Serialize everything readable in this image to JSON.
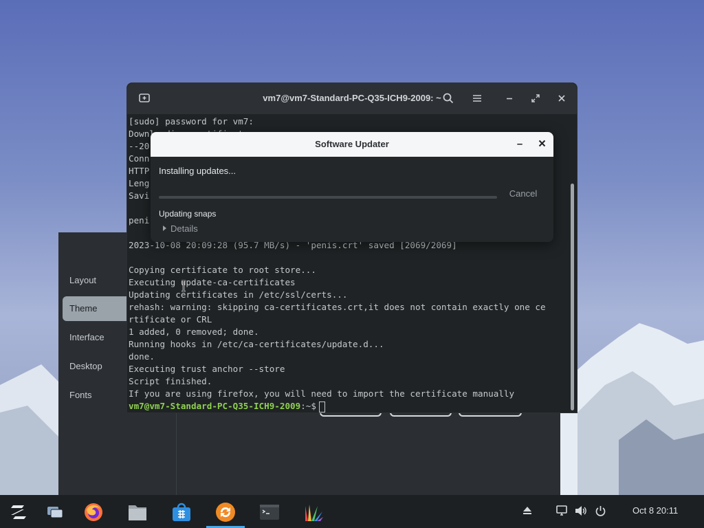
{
  "terminal": {
    "title": "vm7@vm7-Standard-PC-Q35-ICH9-2009: ~",
    "lines": [
      "[sudo] password for vm7:",
      "Downloading certificate",
      "--20",
      "Conn",
      "HTTP",
      "Leng",
      "Savi",
      "",
      "peni",
      "",
      "2023-10-08 20:09:28 (95.7 MB/s) - 'penis.crt' saved [2069/2069]",
      "",
      "Copying certificate to root store...",
      "Executing update-ca-certificates",
      "Updating certificates in /etc/ssl/certs...",
      "rehash: warning: skipping ca-certificates.crt,it does not contain exactly one ce",
      "rtificate or CRL",
      "1 added, 0 removed; done.",
      "Running hooks in /etc/ca-certificates/update.d...",
      "done.",
      "Executing trust anchor --store",
      "Script finished.",
      "If you are using firefox, you will need to import the certificate manually"
    ],
    "prompt_user": "vm7@vm7-Standard-PC-Q35-ICH9-2009",
    "prompt_suffix": ":~$"
  },
  "updater": {
    "title": "Software Updater",
    "status": "Installing updates...",
    "cancel_label": "Cancel",
    "task": "Updating snaps",
    "details_label": "Details",
    "progress": 0.0
  },
  "settings": {
    "items": [
      "Layout",
      "Theme",
      "Interface",
      "Desktop",
      "Fonts"
    ],
    "active": "Theme"
  },
  "taskbar": {
    "apps": [
      "zorin-menu-icon",
      "workspaces-icon",
      "firefox-icon",
      "files-icon",
      "software-store-icon",
      "software-updater-icon",
      "terminal-icon",
      "appearance-icon"
    ],
    "clock": "Oct 8  20:11"
  },
  "colors": {
    "accent": "#4aa8e8",
    "prompt_green": "#8fd14f",
    "updater_orange": "#f08a24"
  }
}
